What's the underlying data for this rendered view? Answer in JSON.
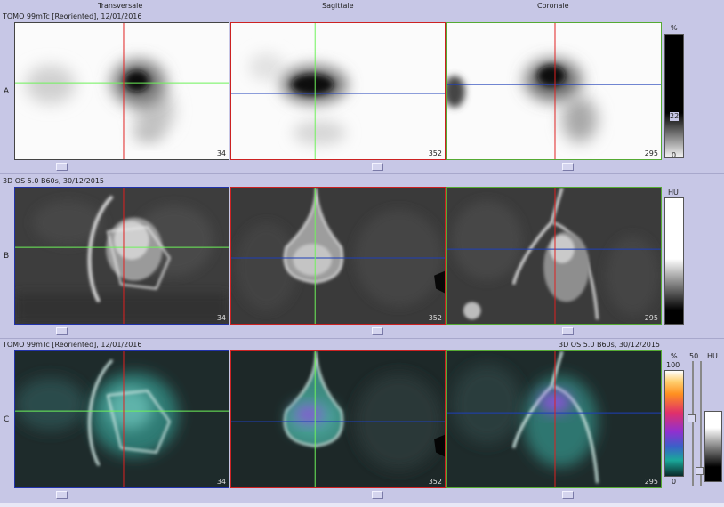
{
  "header": {
    "transversale": "Transversale",
    "sagittale": "Sagittale",
    "coronale": "Coronale"
  },
  "row_labels": {
    "a": "A",
    "b": "B",
    "c": "C"
  },
  "row_a": {
    "series": "TOMO 99mTc [Reoriented], 12/01/2016"
  },
  "row_b": {
    "series": "3D OS 5.0 B60s, 30/12/2015"
  },
  "row_c": {
    "series_left": "TOMO 99mTc [Reoriented], 12/01/2016",
    "series_right": "3D OS 5.0 B60s, 30/12/2015"
  },
  "slices": {
    "transversale": "34",
    "sagittale": "352",
    "coronale": "295"
  },
  "scale_a": {
    "unit": "%",
    "mid": "22",
    "min": "0"
  },
  "scale_b": {
    "unit": "HU"
  },
  "scale_c": {
    "unit_pct": "%",
    "max": "100",
    "min": "0",
    "window": "50",
    "unit_hu": "HU"
  },
  "colors": {
    "crosshair_green": "#6ef25a",
    "crosshair_red": "#e02020",
    "crosshair_blue": "#1e3fb8",
    "frame_transversale": "#2233aa",
    "frame_sagittale": "#cc2222",
    "frame_coronale": "#55aa33",
    "background": "#c7c7e6"
  }
}
